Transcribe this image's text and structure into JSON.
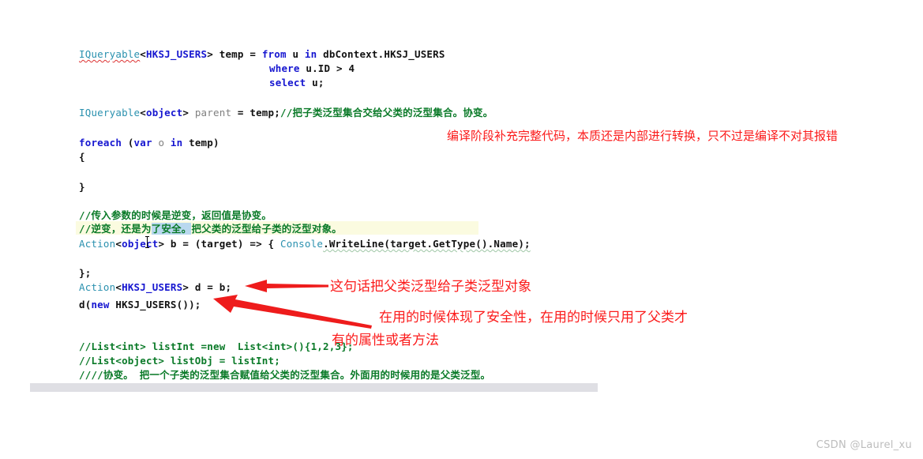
{
  "editor": {
    "language": "csharp",
    "background": "#ffffff",
    "colors": {
      "type": "#2b91af",
      "keyword": "#1616d0",
      "comment": "#0a7a28",
      "variable": "#808080",
      "plain": "#111111",
      "error_squiggle": "#dd3333",
      "line_highlight": "#fbfbe0",
      "selection": "#b9d8ef",
      "annotation_red": "#fb1b1b"
    },
    "lines": [
      {
        "id": "line-1",
        "segments": [
          {
            "text": "IQueryable",
            "kind": "type",
            "squiggle": true
          },
          {
            "text": "<",
            "kind": "plain"
          },
          {
            "text": "HKSJ_USERS",
            "kind": "generic"
          },
          {
            "text": "> ",
            "kind": "plain"
          },
          {
            "text": "temp ",
            "kind": "plain"
          },
          {
            "text": "= ",
            "kind": "plain"
          },
          {
            "text": "from ",
            "kind": "keyword"
          },
          {
            "text": "u ",
            "kind": "plain"
          },
          {
            "text": "in ",
            "kind": "keyword"
          },
          {
            "text": "dbContext.HKSJ_USERS",
            "kind": "plain"
          }
        ]
      },
      {
        "id": "line-2",
        "segments": [
          {
            "text": "where ",
            "kind": "keyword"
          },
          {
            "text": "u.ID > 4",
            "kind": "plain"
          }
        ]
      },
      {
        "id": "line-3",
        "segments": [
          {
            "text": "select ",
            "kind": "keyword"
          },
          {
            "text": "u;",
            "kind": "plain"
          }
        ]
      },
      {
        "id": "line-4",
        "segments": [
          {
            "text": "IQueryable",
            "kind": "type"
          },
          {
            "text": "<",
            "kind": "plain"
          },
          {
            "text": "object",
            "kind": "generic"
          },
          {
            "text": "> ",
            "kind": "plain"
          },
          {
            "text": "parent ",
            "kind": "variable"
          },
          {
            "text": "= ",
            "kind": "plain"
          },
          {
            "text": "temp;",
            "kind": "plain"
          },
          {
            "text": "//把子类泛型集合交给父类的泛型集合。协变。",
            "kind": "comment"
          }
        ]
      },
      {
        "id": "line-5",
        "segments": [
          {
            "text": "foreach ",
            "kind": "keyword"
          },
          {
            "text": "(",
            "kind": "plain"
          },
          {
            "text": "var ",
            "kind": "keyword"
          },
          {
            "text": "o ",
            "kind": "variable"
          },
          {
            "text": "in ",
            "kind": "keyword"
          },
          {
            "text": "temp)",
            "kind": "plain"
          }
        ]
      },
      {
        "id": "line-6",
        "segments": [
          {
            "text": "{",
            "kind": "plain"
          }
        ]
      },
      {
        "id": "line-7",
        "segments": [
          {
            "text": "}",
            "kind": "plain"
          }
        ]
      },
      {
        "id": "line-8",
        "segments": [
          {
            "text": "//传入参数的时候是逆变，返回值是协变。",
            "kind": "comment"
          }
        ]
      },
      {
        "id": "line-9",
        "segments": [
          {
            "text": "//逆变，还是为",
            "kind": "comment"
          },
          {
            "text": "了安全。",
            "kind": "comment",
            "selected": true
          },
          {
            "text": "把父类的泛型给子类的泛型对象。",
            "kind": "comment"
          }
        ]
      },
      {
        "id": "line-10",
        "segments": [
          {
            "text": "Action",
            "kind": "type"
          },
          {
            "text": "<",
            "kind": "plain"
          },
          {
            "text": "object",
            "kind": "generic"
          },
          {
            "text": "> ",
            "kind": "plain"
          },
          {
            "text": "b ",
            "kind": "plain"
          },
          {
            "text": "= ",
            "kind": "plain"
          },
          {
            "text": "(",
            "kind": "plain"
          },
          {
            "text": "target",
            "kind": "plain"
          },
          {
            "text": ") ",
            "kind": "plain"
          },
          {
            "text": "=> { ",
            "kind": "plain"
          },
          {
            "text": "Console",
            "kind": "class"
          },
          {
            "text": ".WriteLine(target.GetType().Name);",
            "kind": "plain"
          }
        ]
      },
      {
        "id": "line-11",
        "segments": [
          {
            "text": "};",
            "kind": "plain"
          }
        ]
      },
      {
        "id": "line-12",
        "segments": [
          {
            "text": "Action",
            "kind": "type"
          },
          {
            "text": "<",
            "kind": "plain"
          },
          {
            "text": "HKSJ_USERS",
            "kind": "generic"
          },
          {
            "text": "> ",
            "kind": "plain"
          },
          {
            "text": "d = b;",
            "kind": "plain"
          }
        ]
      },
      {
        "id": "line-13",
        "segments": [
          {
            "text": "d(",
            "kind": "plain"
          },
          {
            "text": "new ",
            "kind": "keyword"
          },
          {
            "text": "HKSJ_USERS());",
            "kind": "plain"
          }
        ]
      },
      {
        "id": "line-14",
        "segments": [
          {
            "text": "//List<int> listInt =new  List<int>(){1,2,3};",
            "kind": "comment"
          }
        ]
      },
      {
        "id": "line-15",
        "segments": [
          {
            "text": "//List<object> listObj = listInt;",
            "kind": "comment"
          }
        ]
      },
      {
        "id": "line-16",
        "segments": [
          {
            "text": "////协变。 把一个子类的泛型集合赋值给父类的泛型集合。外面用的时候用的是父类泛型。",
            "kind": "comment"
          }
        ]
      }
    ]
  },
  "annotations": [
    {
      "id": "annotation-1",
      "text": "编译阶段补充完整代码，本质还是内部进行转换，只不过是编译不对其报错"
    },
    {
      "id": "annotation-2",
      "text": "这句话把父类泛型给子类泛型对象"
    },
    {
      "id": "annotation-3-line1",
      "text": "在用的时候体现了安全性，在用的时候只用了父类才"
    },
    {
      "id": "annotation-3-line2",
      "text": "有的属性或者方法"
    }
  ],
  "arrows": [
    {
      "id": "arrow-to-action-assign",
      "direction": "left",
      "style": "horizontal-tapered"
    },
    {
      "id": "arrow-to-invoke",
      "direction": "up-left",
      "style": "diagonal-tapered"
    }
  ],
  "scrollbar": {
    "orientation": "horizontal",
    "thumb_fraction": "1.0"
  },
  "watermark": {
    "text": "CSDN @Laurel_xu"
  }
}
